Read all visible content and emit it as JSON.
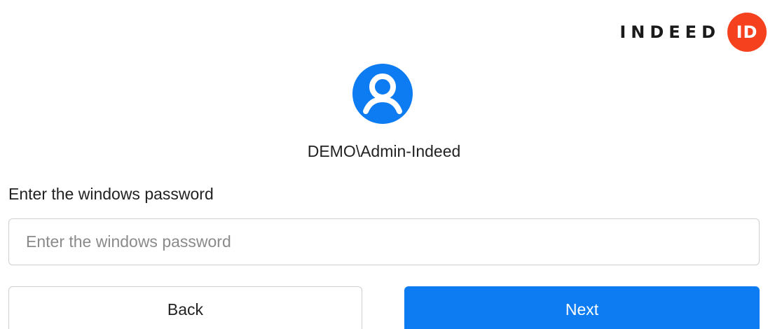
{
  "brand": {
    "logo_text": "INDEED",
    "logo_badge": "ID",
    "badge_color": "#f5411e"
  },
  "user": {
    "avatar_icon": "user-avatar-icon",
    "avatar_color": "#0d7cf2",
    "name": "DEMO\\Admin-Indeed"
  },
  "form": {
    "label": "Enter the windows password",
    "password_placeholder": "Enter the windows password",
    "password_value": ""
  },
  "actions": {
    "back_label": "Back",
    "next_label": "Next",
    "next_color": "#0d7cf2"
  }
}
